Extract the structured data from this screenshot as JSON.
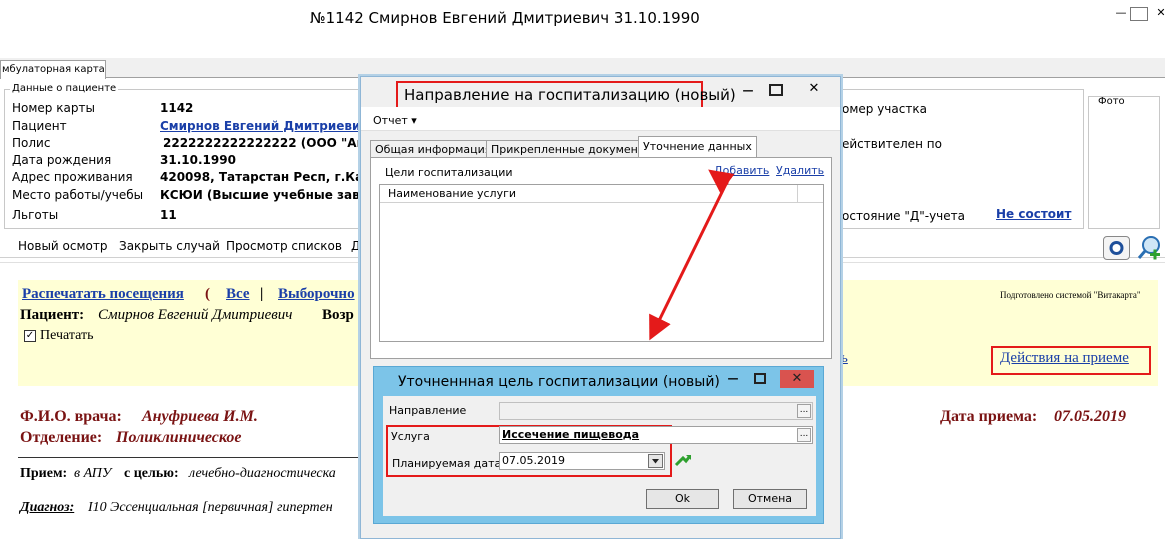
{
  "window": {
    "title": "№1142 Смирнов Евгений Дмитриевич 31.10.1990",
    "minimize": "—",
    "restore": "▭",
    "close": "✕"
  },
  "tab": {
    "label": "мбулаторная карта"
  },
  "patient": {
    "legend": "Данные о пациенте",
    "rows": [
      {
        "label": "Номер карты",
        "value": "1142"
      },
      {
        "label": "Пациент",
        "value": "Смирнов Евгений Дмитриевич"
      },
      {
        "label": "Полис",
        "value": "2222222222222222 (ООО \"Ак"
      },
      {
        "label": "Дата рождения",
        "value": "31.10.1990"
      },
      {
        "label": "Адрес проживания",
        "value": "420098, Татарстан Респ, г.Ка"
      },
      {
        "label": "Место работы/учебы",
        "value": "КСЮИ (Высшие учебные заве"
      },
      {
        "label": "Льготы",
        "value": "11"
      }
    ],
    "right_col1": "омер участка",
    "right_col2": "ействителен по",
    "right_col3": "остояние \"Д\"-учета",
    "d_status": "Не состоит",
    "photo": "Фото"
  },
  "toolbar": {
    "items": [
      "Новый осмотр",
      "Закрыть случай",
      "Просмотр списков",
      "Д"
    ]
  },
  "content": {
    "print_visits": "Распечатать посещения",
    "paren": "(",
    "all": "Все",
    "sep": "|",
    "selective": "Выборочно",
    "prepared": "Подготовлено системой \"Витакарта\"",
    "patient_label": "Пациент:",
    "patient_name": "Смирнов Евгений Дмитриевич",
    "age_label": "Возр",
    "print_check": "Печатать",
    "actions": "Действия на приеме",
    "doctor_label": "Ф.И.О. врача:",
    "doctor": "Ануфриева И.М.",
    "dept_label": "Отделение:",
    "dept": "Поликлиническое",
    "date_label": "Дата приема:",
    "date": "07.05.2019",
    "reception_label": "Прием:",
    "reception_pre": "в АПУ",
    "reception_mid": "с целью:",
    "reception_val": "лечебно-диагностическа",
    "diagnosis_label": "Диагноз:",
    "diagnosis": "I10 Эссенциальная [первичная] гипертен",
    "side_link": "ь"
  },
  "dialog1": {
    "title": "Направление на госпитализацию (новый)",
    "menu": "Отчет ▾",
    "tabs": [
      "Общая информация",
      "Прикрепленные документы",
      "Уточнение данных"
    ],
    "goals_label": "Цели госпитализации",
    "add": "Добавить",
    "delete": "Удалить",
    "grid_header": "Наименование услуги"
  },
  "dialog2": {
    "title": "Уточненнная цель госпитализации (новый)",
    "direction_label": "Направление",
    "service_label": "Услуга",
    "service_value": "Иссечение пищевода",
    "date_label": "Планируемая дата",
    "date_value": "07.05.2019",
    "ok": "Ok",
    "cancel": "Отмена"
  },
  "colors": {
    "accent_red": "#e41a1a",
    "link": "#1a3fa8",
    "maroon": "#7a1313",
    "dialog_blue": "#7cc4e8"
  }
}
